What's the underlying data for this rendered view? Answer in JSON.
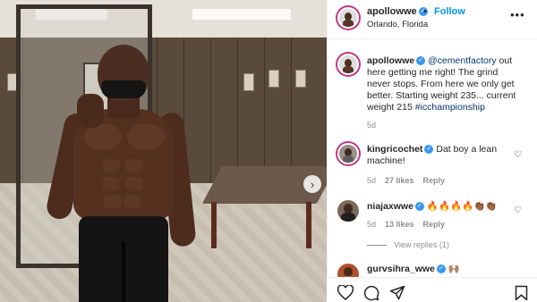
{
  "post": {
    "username": "apollowwe",
    "follow_label": "Follow",
    "location": "Orlando, Florida",
    "more_label": "•••",
    "caption_username": "apollowwe",
    "caption_mention": "@cementfactory",
    "caption_text": " out here getting me right! The grind never stops. From here we only get better. Starting weight 235... current weight 215 ",
    "caption_hashtag": "#icchampionship",
    "caption_age": "5d"
  },
  "comments": [
    {
      "username": "kingricochet",
      "text": "Dat boy a lean machine!",
      "age": "5d",
      "likes": "27 likes",
      "reply_label": "Reply",
      "verified": true
    },
    {
      "username": "niajaxwwe",
      "text": "🔥🔥🔥🔥👏🏾👏🏾",
      "age": "5d",
      "likes": "13 likes",
      "reply_label": "Reply",
      "verified": true
    },
    {
      "username": "gurvsihra_wwe",
      "text": "🙌🏽",
      "verified": true
    }
  ],
  "view_replies_label": "View replies (1)",
  "next_arrow": "›",
  "icons": [
    "heart-icon",
    "comment-icon",
    "share-icon",
    "bookmark-icon",
    "more-icon",
    "next-arrow-icon",
    "verified-badge-icon"
  ],
  "colors": {
    "link": "#0095f6",
    "mention": "#00376b",
    "meta": "#8e8e8e",
    "verified": "#3897f0"
  }
}
